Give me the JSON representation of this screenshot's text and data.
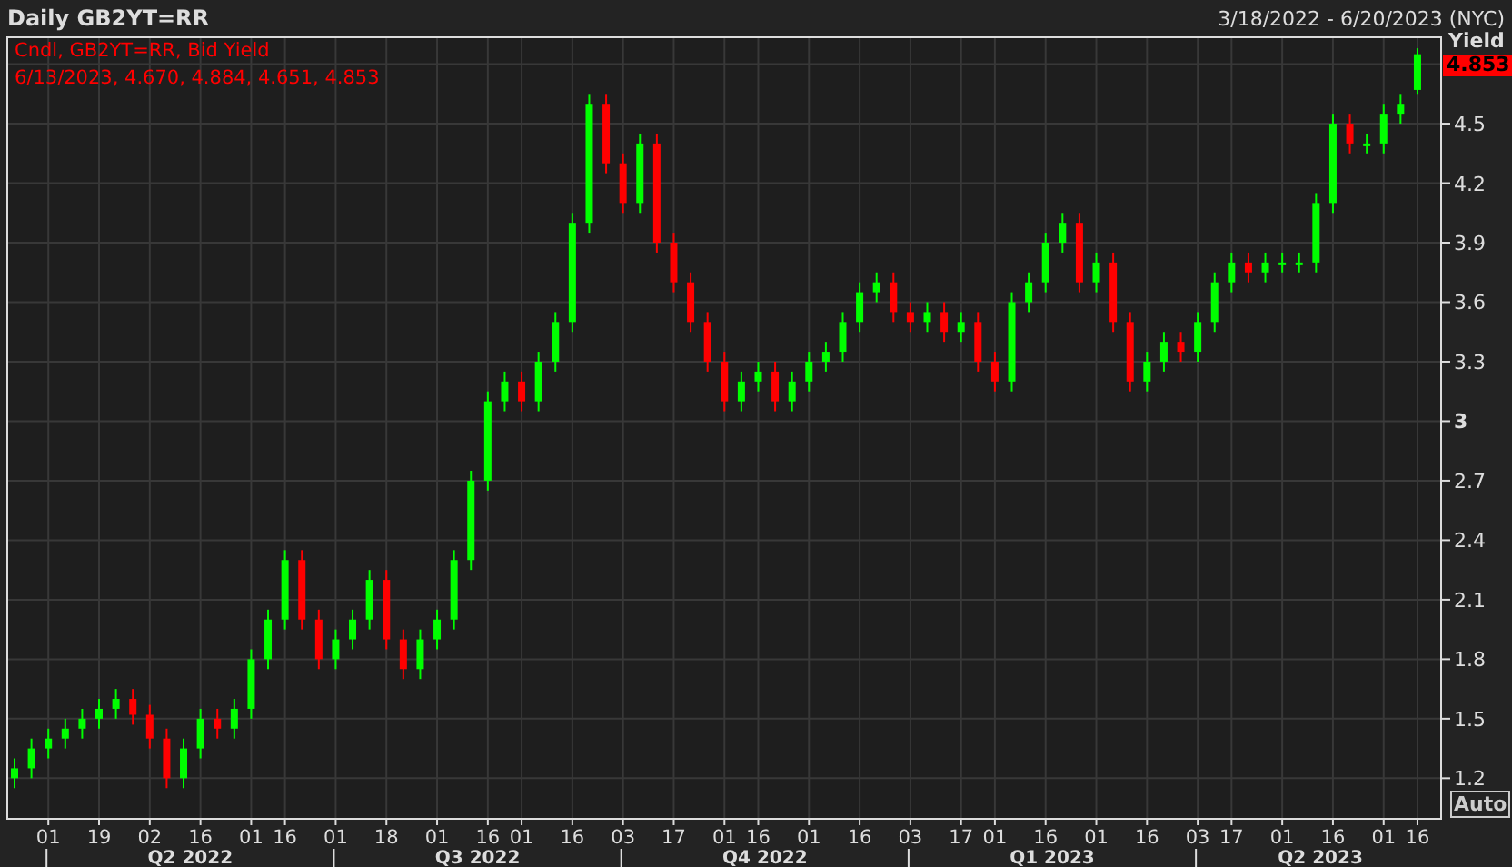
{
  "header": {
    "title": "Daily GB2YT=RR",
    "range": "3/18/2022 - 6/20/2023 (NYC)"
  },
  "legend": [
    "Cndl, GB2YT=RR, Bid Yield",
    "6/13/2023, 4.670, 4.884, 4.651, 4.853"
  ],
  "last_value": "4.853",
  "auto_button": "Auto",
  "chart_data": {
    "type": "candlestick",
    "ylabel": "Yield",
    "ylim": [
      1.0,
      4.94
    ],
    "yticks": [
      4.5,
      4.2,
      3.9,
      3.6,
      3.3,
      3,
      2.7,
      2.4,
      2.1,
      1.8,
      1.5,
      1.2
    ],
    "grid": true,
    "categories": [
      null,
      null,
      "01",
      null,
      null,
      "19",
      null,
      null,
      "02",
      null,
      null,
      "16",
      null,
      null,
      "01",
      null,
      "16",
      null,
      null,
      "01",
      null,
      null,
      "18",
      null,
      null,
      "01",
      null,
      null,
      "16",
      null,
      "01",
      null,
      null,
      "16",
      null,
      null,
      "03",
      null,
      null,
      "17",
      null,
      null,
      "01",
      null,
      "16",
      null,
      null,
      "01",
      null,
      null,
      "16",
      null,
      null,
      "03",
      null,
      null,
      "17",
      null,
      "01",
      null,
      null,
      "16",
      null,
      null,
      "01",
      null,
      null,
      "16",
      null,
      null,
      "03",
      null,
      "17",
      null,
      null,
      "01",
      null,
      null,
      "16",
      null,
      null,
      "01",
      null,
      "16"
    ],
    "ohlc": [
      [
        1.2,
        1.3,
        1.15,
        1.25
      ],
      [
        1.25,
        1.4,
        1.2,
        1.35
      ],
      [
        1.35,
        1.45,
        1.3,
        1.4
      ],
      [
        1.4,
        1.5,
        1.35,
        1.45
      ],
      [
        1.45,
        1.55,
        1.4,
        1.5
      ],
      [
        1.5,
        1.6,
        1.45,
        1.55
      ],
      [
        1.55,
        1.65,
        1.5,
        1.6
      ],
      [
        1.6,
        1.65,
        1.47,
        1.52
      ],
      [
        1.52,
        1.57,
        1.35,
        1.4
      ],
      [
        1.4,
        1.45,
        1.15,
        1.2
      ],
      [
        1.2,
        1.4,
        1.15,
        1.35
      ],
      [
        1.35,
        1.55,
        1.3,
        1.5
      ],
      [
        1.5,
        1.55,
        1.4,
        1.45
      ],
      [
        1.45,
        1.6,
        1.4,
        1.55
      ],
      [
        1.55,
        1.85,
        1.5,
        1.8
      ],
      [
        1.8,
        2.05,
        1.75,
        2.0
      ],
      [
        2.0,
        2.35,
        1.95,
        2.3
      ],
      [
        2.3,
        2.35,
        1.95,
        2.0
      ],
      [
        2.0,
        2.05,
        1.75,
        1.8
      ],
      [
        1.8,
        1.95,
        1.75,
        1.9
      ],
      [
        1.9,
        2.05,
        1.85,
        2.0
      ],
      [
        2.0,
        2.25,
        1.95,
        2.2
      ],
      [
        2.2,
        2.25,
        1.85,
        1.9
      ],
      [
        1.9,
        1.95,
        1.7,
        1.75
      ],
      [
        1.75,
        1.95,
        1.7,
        1.9
      ],
      [
        1.9,
        2.05,
        1.85,
        2.0
      ],
      [
        2.0,
        2.35,
        1.95,
        2.3
      ],
      [
        2.3,
        2.75,
        2.25,
        2.7
      ],
      [
        2.7,
        3.15,
        2.65,
        3.1
      ],
      [
        3.1,
        3.25,
        3.05,
        3.2
      ],
      [
        3.2,
        3.25,
        3.05,
        3.1
      ],
      [
        3.1,
        3.35,
        3.05,
        3.3
      ],
      [
        3.3,
        3.55,
        3.25,
        3.5
      ],
      [
        3.5,
        4.05,
        3.45,
        4.0
      ],
      [
        4.0,
        4.65,
        3.95,
        4.6
      ],
      [
        4.6,
        4.65,
        4.25,
        4.3
      ],
      [
        4.3,
        4.35,
        4.05,
        4.1
      ],
      [
        4.1,
        4.45,
        4.05,
        4.4
      ],
      [
        4.4,
        4.45,
        3.85,
        3.9
      ],
      [
        3.9,
        3.95,
        3.65,
        3.7
      ],
      [
        3.7,
        3.75,
        3.45,
        3.5
      ],
      [
        3.5,
        3.55,
        3.25,
        3.3
      ],
      [
        3.3,
        3.35,
        3.05,
        3.1
      ],
      [
        3.1,
        3.25,
        3.05,
        3.2
      ],
      [
        3.2,
        3.3,
        3.15,
        3.25
      ],
      [
        3.25,
        3.3,
        3.05,
        3.1
      ],
      [
        3.1,
        3.25,
        3.05,
        3.2
      ],
      [
        3.2,
        3.35,
        3.15,
        3.3
      ],
      [
        3.3,
        3.4,
        3.25,
        3.35
      ],
      [
        3.35,
        3.55,
        3.3,
        3.5
      ],
      [
        3.5,
        3.7,
        3.45,
        3.65
      ],
      [
        3.65,
        3.75,
        3.6,
        3.7
      ],
      [
        3.7,
        3.75,
        3.5,
        3.55
      ],
      [
        3.55,
        3.6,
        3.45,
        3.5
      ],
      [
        3.5,
        3.6,
        3.45,
        3.55
      ],
      [
        3.55,
        3.6,
        3.4,
        3.45
      ],
      [
        3.45,
        3.55,
        3.4,
        3.5
      ],
      [
        3.5,
        3.55,
        3.25,
        3.3
      ],
      [
        3.3,
        3.35,
        3.15,
        3.2
      ],
      [
        3.2,
        3.65,
        3.15,
        3.6
      ],
      [
        3.6,
        3.75,
        3.55,
        3.7
      ],
      [
        3.7,
        3.95,
        3.65,
        3.9
      ],
      [
        3.9,
        4.05,
        3.85,
        4.0
      ],
      [
        4.0,
        4.05,
        3.65,
        3.7
      ],
      [
        3.7,
        3.85,
        3.65,
        3.8
      ],
      [
        3.8,
        3.85,
        3.45,
        3.5
      ],
      [
        3.5,
        3.55,
        3.15,
        3.2
      ],
      [
        3.2,
        3.35,
        3.15,
        3.3
      ],
      [
        3.3,
        3.45,
        3.25,
        3.4
      ],
      [
        3.4,
        3.45,
        3.3,
        3.35
      ],
      [
        3.35,
        3.55,
        3.3,
        3.5
      ],
      [
        3.5,
        3.75,
        3.45,
        3.7
      ],
      [
        3.7,
        3.85,
        3.65,
        3.8
      ],
      [
        3.8,
        3.85,
        3.7,
        3.75
      ],
      [
        3.75,
        3.85,
        3.7,
        3.8
      ],
      [
        3.8,
        3.85,
        3.75,
        3.8
      ],
      [
        3.8,
        3.85,
        3.75,
        3.8
      ],
      [
        3.8,
        4.15,
        3.75,
        4.1
      ],
      [
        4.1,
        4.55,
        4.05,
        4.5
      ],
      [
        4.5,
        4.55,
        4.35,
        4.4
      ],
      [
        4.4,
        4.45,
        4.35,
        4.4
      ],
      [
        4.4,
        4.6,
        4.35,
        4.55
      ],
      [
        4.55,
        4.65,
        4.5,
        4.6
      ],
      [
        4.67,
        4.88,
        4.65,
        4.85
      ]
    ]
  },
  "x_axis": {
    "quarters": [
      "Q2 2022",
      "Q3 2022",
      "Q4 2022",
      "Q1 2023",
      "Q2 2023"
    ]
  }
}
